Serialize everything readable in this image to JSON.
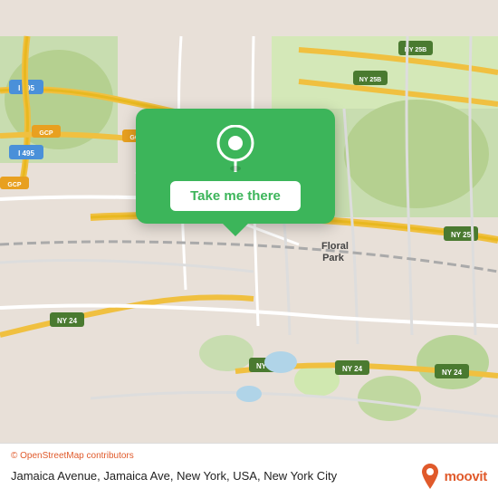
{
  "map": {
    "attribution": "© OpenStreetMap contributors",
    "attribution_color": "#e05a2b"
  },
  "popup": {
    "button_label": "Take me there",
    "background_color": "#3cb55a",
    "button_text_color": "#3cb55a"
  },
  "bottom_bar": {
    "location_name": "Jamaica Avenue, Jamaica Ave, New York, USA,",
    "city": "New York City"
  },
  "moovit": {
    "label": "moovit"
  }
}
